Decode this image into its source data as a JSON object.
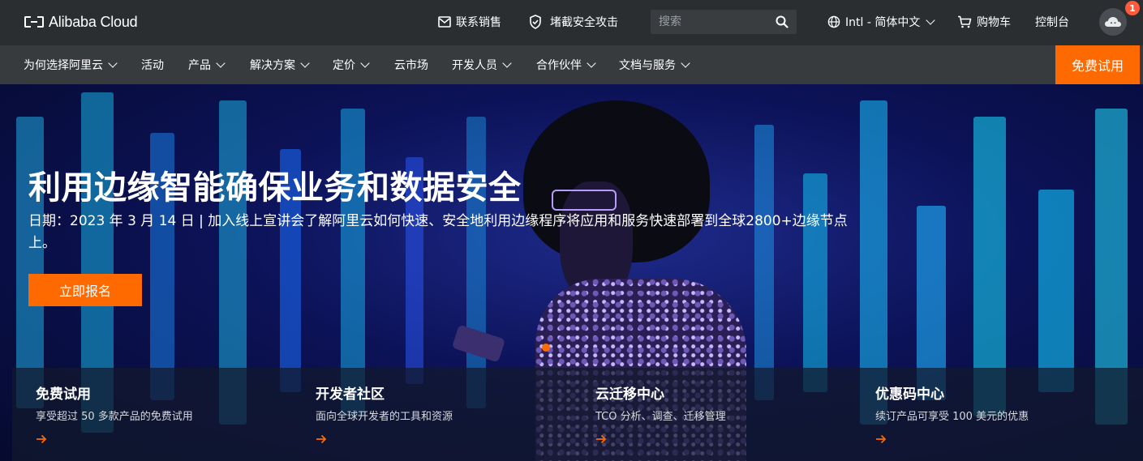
{
  "header": {
    "logo_text": "Alibaba Cloud",
    "contact_sales": "联系销售",
    "stop_attack": "堵截安全攻击",
    "search_placeholder": "搜索",
    "language": "Intl - 简体中文",
    "cart": "购物车",
    "console": "控制台",
    "notification_count": "1"
  },
  "nav": {
    "items": [
      {
        "label": "为何选择阿里云",
        "has_dropdown": true
      },
      {
        "label": "活动",
        "has_dropdown": false
      },
      {
        "label": "产品",
        "has_dropdown": true
      },
      {
        "label": "解决方案",
        "has_dropdown": true
      },
      {
        "label": "定价",
        "has_dropdown": true
      },
      {
        "label": "云市场",
        "has_dropdown": false
      },
      {
        "label": "开发人员",
        "has_dropdown": true
      },
      {
        "label": "合作伙伴",
        "has_dropdown": true
      },
      {
        "label": "文档与服务",
        "has_dropdown": true
      }
    ],
    "free_trial": "免费试用"
  },
  "hero": {
    "title": "利用边缘智能确保业务和数据安全",
    "subtitle": "日期：2023 年 3 月 14 日 | 加入线上宣讲会了解阿里云如何快速、安全地利用边缘程序将应用和服务快速部署到全球2800+边缘节点上。",
    "cta_label": "立即报名"
  },
  "cards": [
    {
      "title": "免费试用",
      "desc": "享受超过 50 多款产品的免费试用"
    },
    {
      "title": "开发者社区",
      "desc": "面向全球开发者的工具和资源"
    },
    {
      "title": "云迁移中心",
      "desc": "TCO 分析、调查、迁移管理"
    },
    {
      "title": "优惠码中心",
      "desc": "续订产品可享受 100 美元的优惠"
    }
  ],
  "colors": {
    "accent": "#ff6a00",
    "topbar_bg": "#2b2e31",
    "navbar_bg": "#383b3e",
    "badge": "#ff5a3c"
  }
}
